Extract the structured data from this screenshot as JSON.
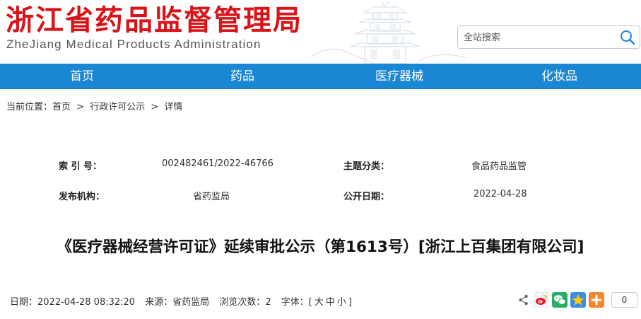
{
  "header": {
    "logo_cn": "浙江省药品监督管理局",
    "logo_en": "ZheJiang Medical Products Administration",
    "search_placeholder": "全站搜索"
  },
  "nav": {
    "items": [
      "首页",
      "药品",
      "医疗器械",
      "化妆品"
    ]
  },
  "breadcrumb": {
    "prefix": "当前位置：",
    "items": [
      "首页",
      ">",
      "行政许可公示",
      ">",
      "详情"
    ]
  },
  "meta": {
    "index_label": "索 引 号：",
    "index_value": "002482461/2022-46766",
    "category_label": "主题分类：",
    "category_value": "食品药品监管",
    "publisher_label": "发布机构：",
    "publisher_value": "省药监局",
    "date_label": "公开日期：",
    "date_value": "2022-04-28"
  },
  "article": {
    "title": "《医疗器械经营许可证》延续审批公示（第1613号）[浙江上百集团有限公司]"
  },
  "info": {
    "date": "日期：2022-04-28 08:32:20",
    "source": "来源：省药监局",
    "views": "浏览次数：2",
    "font_label": "字体：[",
    "font_big": "大",
    "font_mid": "中",
    "font_small": "小",
    "font_end": "]"
  },
  "share": {
    "count": "0",
    "icons": [
      "share-icon",
      "weibo-icon",
      "wechat-icon",
      "qzone-icon",
      "more-share-icon"
    ]
  },
  "colors": {
    "brand_red": "#d7141a",
    "nav_blue": "#1a87d5"
  }
}
